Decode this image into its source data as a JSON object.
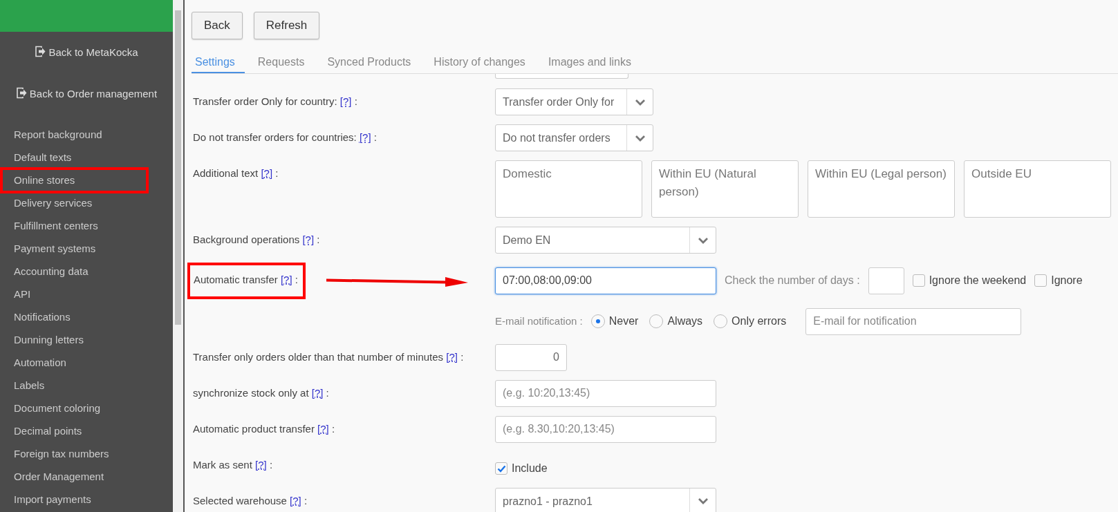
{
  "sidebar": {
    "links": [
      {
        "text": "Back to MetaKocka"
      },
      {
        "text": "Back to Order management"
      }
    ],
    "items": [
      {
        "text": "Report background",
        "highlighted": false
      },
      {
        "text": "Default texts",
        "highlighted": false
      },
      {
        "text": "Online stores",
        "highlighted": true
      },
      {
        "text": "Delivery services",
        "highlighted": false
      },
      {
        "text": "Fulfillment centers",
        "highlighted": false
      },
      {
        "text": "Payment systems",
        "highlighted": false
      },
      {
        "text": "Accounting data",
        "highlighted": false
      },
      {
        "text": "API",
        "highlighted": false
      },
      {
        "text": "Notifications",
        "highlighted": false
      },
      {
        "text": "Dunning letters",
        "highlighted": false
      },
      {
        "text": "Automation",
        "highlighted": false
      },
      {
        "text": "Labels",
        "highlighted": false
      },
      {
        "text": "Document coloring",
        "highlighted": false
      },
      {
        "text": "Decimal points",
        "highlighted": false
      },
      {
        "text": "Foreign tax numbers",
        "highlighted": false
      },
      {
        "text": "Order Management",
        "highlighted": false
      },
      {
        "text": "Import payments",
        "highlighted": false
      }
    ]
  },
  "toolbar": {
    "buttons": [
      "Back",
      "Refresh"
    ]
  },
  "tabs": [
    {
      "label": "Settings",
      "selected": true
    },
    {
      "label": "Requests",
      "selected": false
    },
    {
      "label": "Synced Products",
      "selected": false
    },
    {
      "label": "History of changes",
      "selected": false
    },
    {
      "label": "Images and links",
      "selected": false
    }
  ],
  "form": {
    "rows": [
      {
        "kind": "partial"
      },
      {
        "kind": "select",
        "label": "Transfer order Only for country:",
        "help": "[?]",
        "tail": ":",
        "value": "Transfer order Only for"
      },
      {
        "kind": "select",
        "label": "Do not transfer orders for countries:",
        "help": "[?]",
        "tail": ":",
        "value": "Do not transfer orders"
      },
      {
        "kind": "textareas",
        "label": "Additional text",
        "help": "[?]",
        "tail": ":",
        "placeholders": [
          "Domestic",
          "Within EU (Natural person)",
          "Within EU (Legal person)",
          "Outside EU"
        ]
      },
      {
        "kind": "wide_select",
        "label": "Background operations",
        "help": "[?]",
        "tail": ":",
        "value": "Demo EN"
      },
      {
        "kind": "time",
        "label": "Automatic transfer",
        "help": "[?]",
        "tail": ":",
        "value": "07:00,08:00,09:00",
        "focused": true,
        "highlighted": true,
        "arrow": true,
        "days_label": "Check the number of days :",
        "checks": [
          {
            "label": "Ignore the weekend",
            "checked": false
          },
          {
            "label": "Ignore",
            "checked": false
          }
        ]
      },
      {
        "kind": "notify",
        "label": "E-mail notification :",
        "options": [
          {
            "label": "Never",
            "selected": true
          },
          {
            "label": "Always",
            "selected": false
          },
          {
            "label": "Only errors",
            "selected": false
          }
        ],
        "placeholder": "E-mail for notification"
      },
      {
        "kind": "number",
        "label": "Transfer only orders older than that number of minutes",
        "help": "[?]",
        "tail": ":",
        "value": "0"
      },
      {
        "kind": "text",
        "label": "synchronize stock only at",
        "help": "[?]",
        "tail": ":",
        "placeholder": "(e.g. 10:20,13:45)"
      },
      {
        "kind": "text",
        "label": "Automatic product transfer",
        "help": "[?]",
        "tail": ":",
        "placeholder": "(e.g. 8.30,10:20,13:45)"
      },
      {
        "kind": "checkbox",
        "label": "Mark as sent",
        "help": "[?]",
        "tail": ":",
        "option": "Include",
        "checked": true
      },
      {
        "kind": "wide_select",
        "label": "Selected warehouse",
        "help": "[?]",
        "tail": ":",
        "value": "prazno1 - prazno1"
      }
    ]
  }
}
